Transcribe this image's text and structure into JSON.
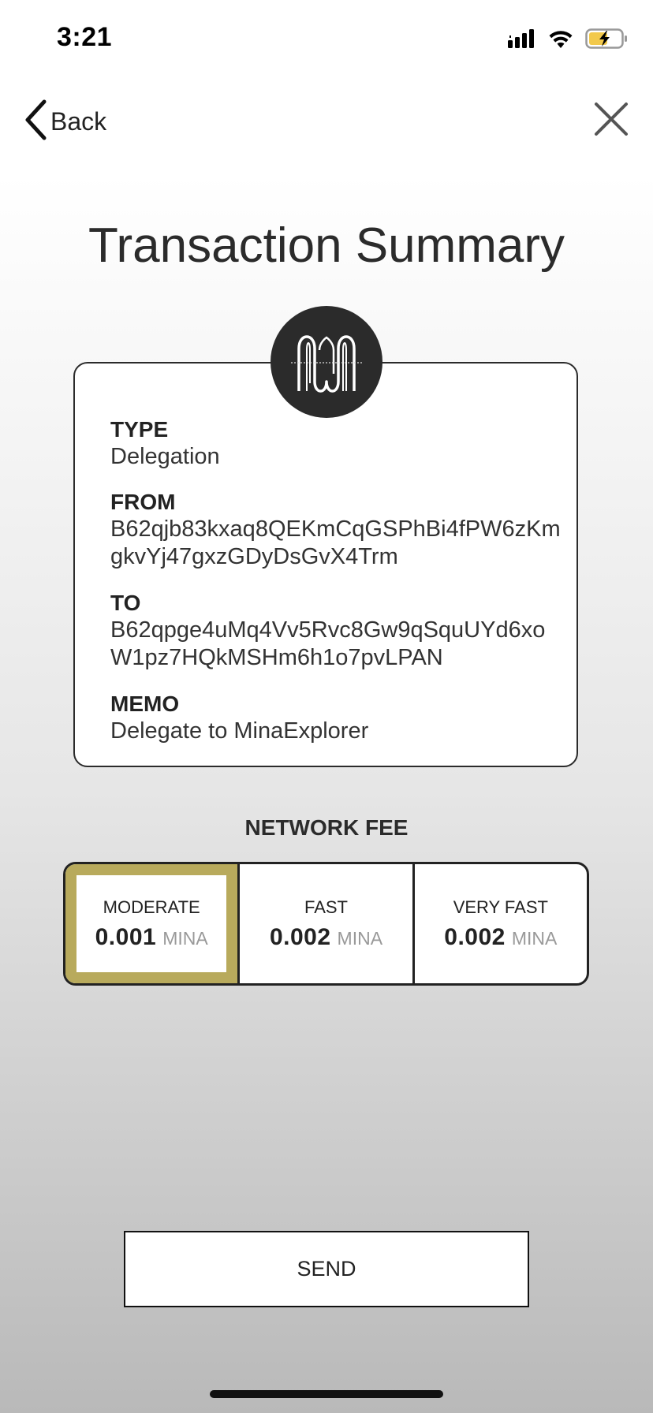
{
  "status_bar": {
    "time": "3:21",
    "icons": [
      "signal-icon",
      "wifi-icon",
      "battery-charging-icon"
    ]
  },
  "nav": {
    "back_label": "Back",
    "close_icon": "close-icon"
  },
  "title": "Transaction Summary",
  "logo": {
    "icon": "mina-logo-icon"
  },
  "summary": {
    "type_label": "TYPE",
    "type_value": "Delegation",
    "from_label": "FROM",
    "from_value": "B62qjb83kxaq8QEKmCqGSPhBi4fPW6zKmgkvYj47gxzGDyDsGvX4Trm",
    "to_label": "TO",
    "to_value": "B62qpge4uMq4Vv5Rvc8Gw9qSquUYd6xoW1pz7HQkMSHm6h1o7pvLPAN",
    "memo_label": "MEMO",
    "memo_value": "Delegate to MinaExplorer"
  },
  "fee": {
    "title": "NETWORK FEE",
    "options": [
      {
        "label": "MODERATE",
        "amount": "0.001",
        "unit": "MINA",
        "selected": true
      },
      {
        "label": "FAST",
        "amount": "0.002",
        "unit": "MINA",
        "selected": false
      },
      {
        "label": "VERY FAST",
        "amount": "0.002",
        "unit": "MINA",
        "selected": false
      }
    ]
  },
  "send_label": "SEND",
  "colors": {
    "accent": "#b8aa5c",
    "text": "#222222",
    "unit_text": "#999999"
  }
}
